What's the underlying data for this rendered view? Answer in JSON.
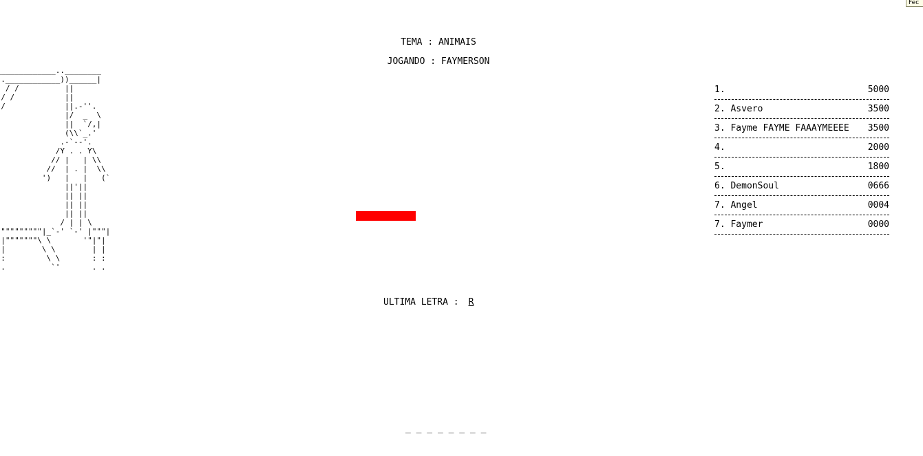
{
  "window": {
    "close_label": "Fec"
  },
  "game": {
    "theme_label": "TEMA : ANIMAIS",
    "player_label": "JOGANDO : FAYMERSON",
    "last_letter_label": "ULTIMA LETRA :",
    "last_letter": "R",
    "word_slots": "_ _ _ _ _ _ _ _",
    "gallows_art": " _____________..________\n| .____________))______|\n|| / /          ||\n||/ /           ||\n||/             ||.-''.\n||              |/  _  \\\n||              ||  `/,|\n||              (\\\\`_.'\n||             .-`--'.\n||            /Y . . Y\\\n||           // |   | \\\\\n||          //  | . |  \\\\\n||         ')   |   |   (`\n||              ||'||\n||              || ||\n||              || ||\n||              || ||\n||             / | | \\\n\"\"\"\"\"\"\"\"\"\"\"|_`-' `-' |\"\"\"|\n|\"|\"\"\"\"\"\"\"\\ \\       '\"|\"|\n| |        \\ \\        | |\n: :         \\ \\       : :\n. .          `'       . ."
  },
  "colors": {
    "wrong_bar": "#ff0000"
  },
  "scoreboard": [
    {
      "rank": "1.",
      "name": "",
      "score": "5000"
    },
    {
      "rank": "2.",
      "name": "Asvero",
      "score": "3500"
    },
    {
      "rank": "3.",
      "name": "Fayme FAYME FAAAYMEEEE",
      "score": "3500"
    },
    {
      "rank": "4.",
      "name": "",
      "score": "2000"
    },
    {
      "rank": "5.",
      "name": "",
      "score": "1800"
    },
    {
      "rank": "6.",
      "name": "DemonSoul",
      "score": "0666"
    },
    {
      "rank": "7.",
      "name": "Angel",
      "score": "0004"
    },
    {
      "rank": "7.",
      "name": "Faymer",
      "score": "0000"
    }
  ]
}
